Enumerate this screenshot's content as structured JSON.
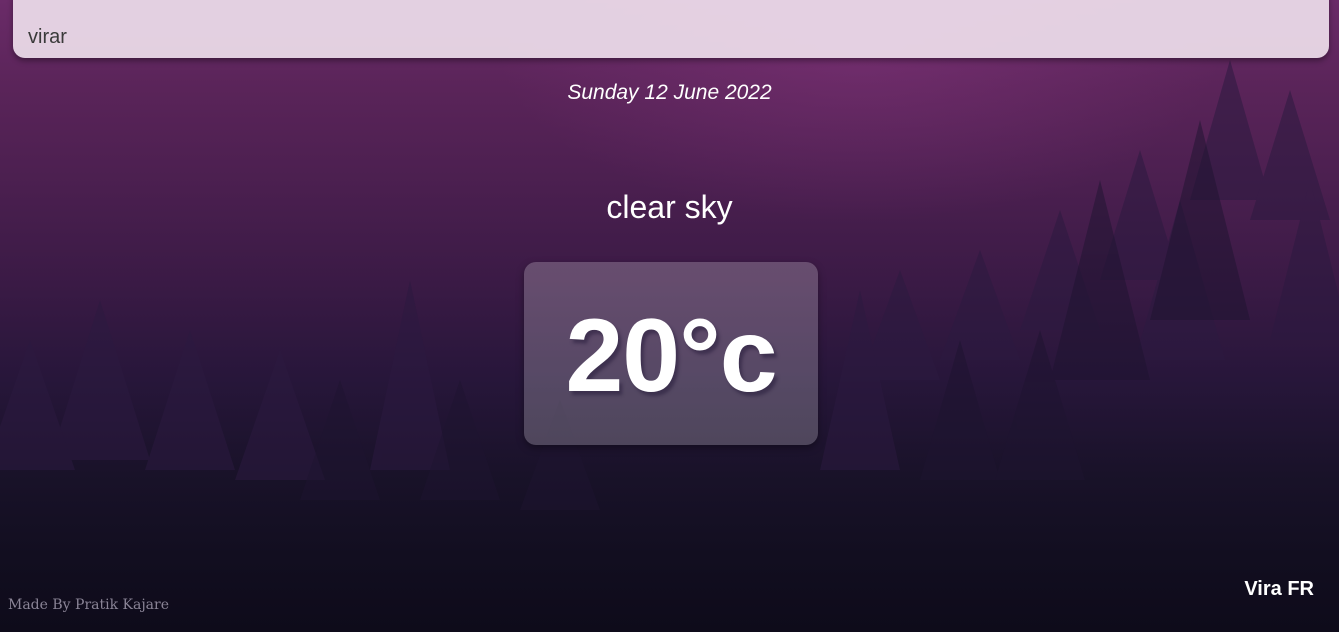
{
  "search": {
    "value": "virar"
  },
  "date": "Sunday 12 June 2022",
  "weather": {
    "condition": "clear sky",
    "temperature": "20°c"
  },
  "location": "Vira FR",
  "footer": {
    "credit": "Made By Pratik Kajare"
  },
  "colors": {
    "background_top": "#6a2b68",
    "background_bottom": "#0e0b1a",
    "search_bar": "#eedeec",
    "text": "#ffffff"
  }
}
